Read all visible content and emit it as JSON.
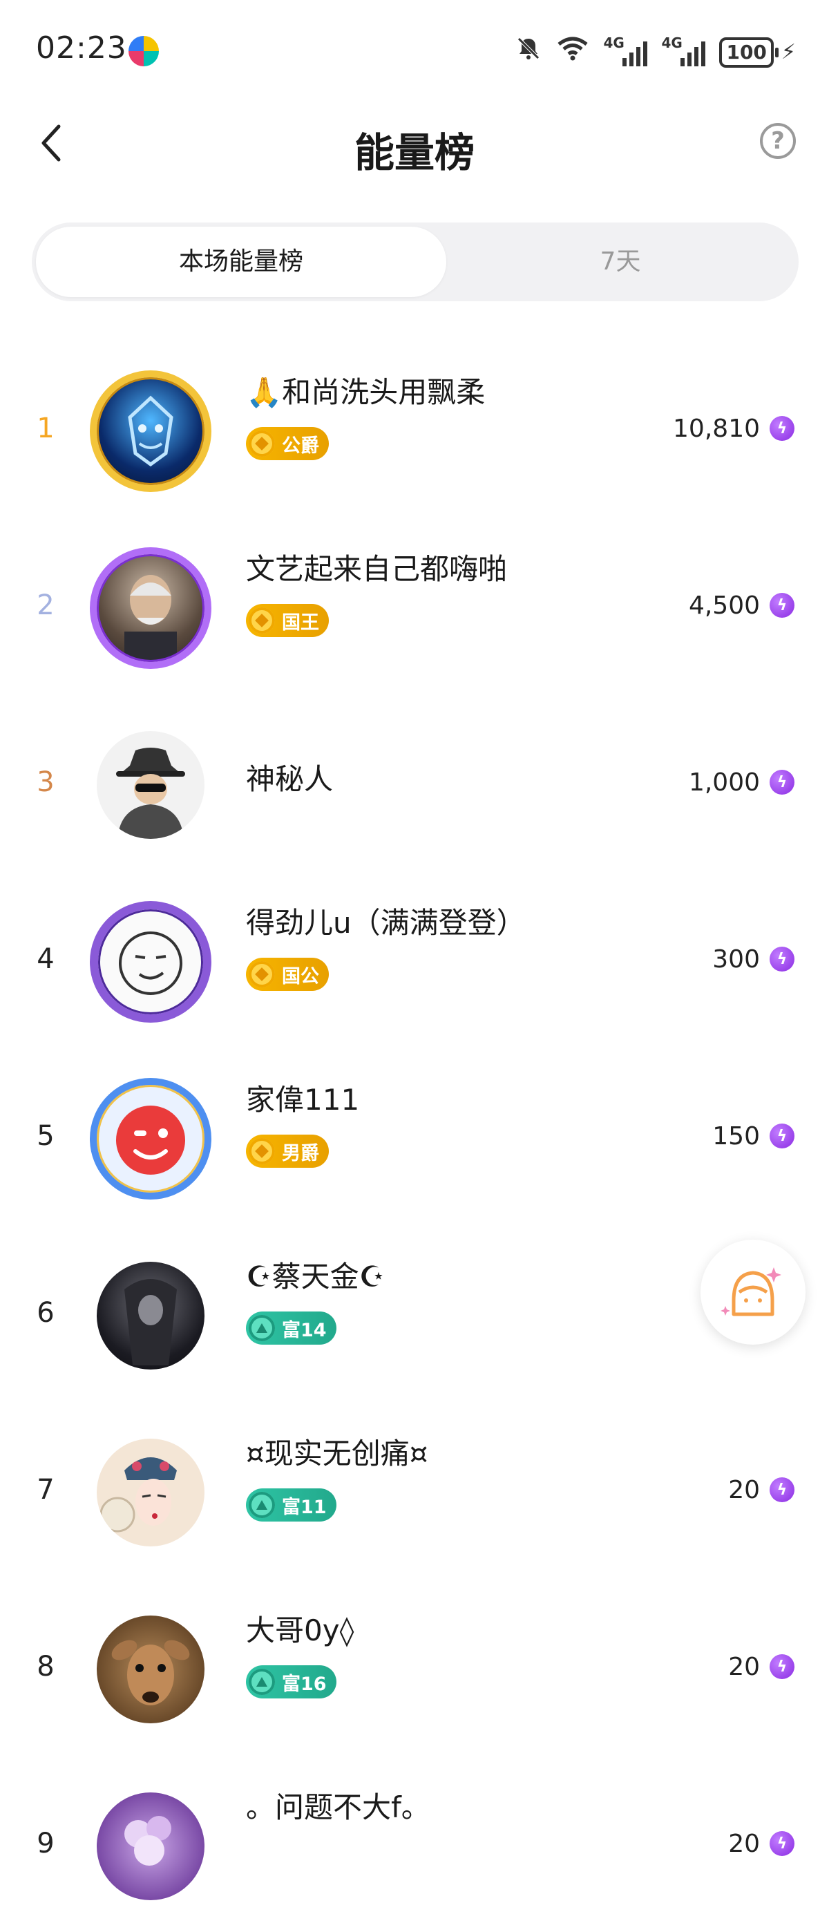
{
  "status_bar": {
    "time": "02:23",
    "network_1": "4G",
    "network_2": "4G",
    "battery": "100"
  },
  "header": {
    "title": "能量榜",
    "help_icon": "?"
  },
  "tabs": [
    {
      "label": "本场能量榜",
      "active": true
    },
    {
      "label": "7天",
      "active": false
    }
  ],
  "colors": {
    "rank_1": "#F5A623",
    "rank_2": "#A3B1E0",
    "rank_3": "#D4874A",
    "energy": "#9B3DF0"
  },
  "rows": [
    {
      "rank": "1",
      "name": "🙏和尚洗头用飘柔",
      "badge": "公爵",
      "badge_type": "gold",
      "score": "10,810",
      "avatar": "tiger-avatar"
    },
    {
      "rank": "2",
      "name": "文艺起来自己都嗨啪",
      "badge": "国王",
      "badge_type": "gold",
      "score": "4,500",
      "avatar": "old-man-avatar"
    },
    {
      "rank": "3",
      "name": "神秘人",
      "badge": "",
      "badge_type": "",
      "score": "1,000",
      "avatar": "mystery-avatar"
    },
    {
      "rank": "4",
      "name": "得劲儿u（满满登登）",
      "badge": "国公",
      "badge_type": "gold",
      "score": "300",
      "avatar": "sketch-face-avatar"
    },
    {
      "rank": "5",
      "name": "家偉111",
      "badge": "男爵",
      "badge_type": "gold",
      "score": "150",
      "avatar": "red-smile-avatar"
    },
    {
      "rank": "6",
      "name": "☪蔡天金☪",
      "badge": "富14",
      "badge_type": "teal",
      "score": "",
      "avatar": "dark-figure-avatar"
    },
    {
      "rank": "7",
      "name": "¤现实无创痛¤",
      "badge": "富11",
      "badge_type": "teal",
      "score": "20",
      "avatar": "opera-avatar"
    },
    {
      "rank": "8",
      "name": "大哥0y◊",
      "badge": "富16",
      "badge_type": "teal",
      "score": "20",
      "avatar": "deer-avatar"
    },
    {
      "rank": "9",
      "name": "。问题不大f。",
      "badge": "",
      "badge_type": "",
      "score": "20",
      "avatar": "flower-avatar"
    }
  ]
}
